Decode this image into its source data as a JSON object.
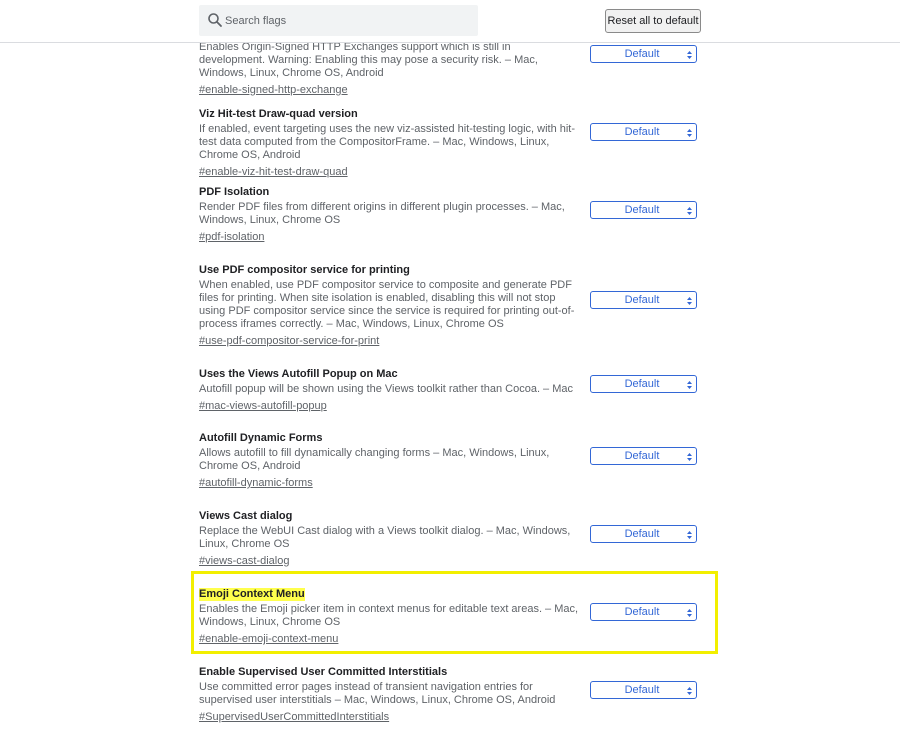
{
  "header": {
    "search_placeholder": "Search flags",
    "reset_label": "Reset all to default"
  },
  "experiments": [
    {
      "title": "",
      "description": "Enables Origin-Signed HTTP Exchanges support which is still in development. Warning: Enabling this may pose a security risk. – Mac, Windows, Linux, Chrome OS, Android",
      "link": "#enable-signed-http-exchange",
      "value": "Default"
    },
    {
      "title": "Viz Hit-test Draw-quad version",
      "description": "If enabled, event targeting uses the new viz-assisted hit-testing logic, with hit-test data computed from the CompositorFrame. – Mac, Windows, Linux, Chrome OS, Android",
      "link": "#enable-viz-hit-test-draw-quad",
      "value": "Default"
    },
    {
      "title": "PDF Isolation",
      "description": "Render PDF files from different origins in different plugin processes. – Mac, Windows, Linux, Chrome OS",
      "link": "#pdf-isolation",
      "value": "Default"
    },
    {
      "title": "Use PDF compositor service for printing",
      "description": "When enabled, use PDF compositor service to composite and generate PDF files for printing. When site isolation is enabled, disabling this will not stop using PDF compositor service since the service is required for printing out-of-process iframes correctly. – Mac, Windows, Linux, Chrome OS",
      "link": "#use-pdf-compositor-service-for-print",
      "value": "Default"
    },
    {
      "title": "Uses the Views Autofill Popup on Mac",
      "description": "Autofill popup will be shown using the Views toolkit rather than Cocoa. – Mac",
      "link": "#mac-views-autofill-popup",
      "value": "Default"
    },
    {
      "title": "Autofill Dynamic Forms",
      "description": "Allows autofill to fill dynamically changing forms – Mac, Windows, Linux, Chrome OS, Android",
      "link": "#autofill-dynamic-forms",
      "value": "Default"
    },
    {
      "title": "Views Cast dialog",
      "description": "Replace the WebUI Cast dialog with a Views toolkit dialog. – Mac, Windows, Linux, Chrome OS",
      "link": "#views-cast-dialog",
      "value": "Default"
    },
    {
      "title": "Emoji Context Menu",
      "description": "Enables the Emoji picker item in context menus for editable text areas. – Mac, Windows, Linux, Chrome OS",
      "link": "#enable-emoji-context-menu",
      "value": "Default"
    },
    {
      "title": "Enable Supervised User Committed Interstitials",
      "description": "Use committed error pages instead of transient navigation entries for supervised user interstitials – Mac, Windows, Linux, Chrome OS, Android",
      "link": "#SupervisedUserCommittedInterstitials",
      "value": "Default"
    }
  ],
  "colors": {
    "accent": "#3367d6",
    "highlight_box": "#f2ef00",
    "title_highlight": "#ffff4d"
  }
}
